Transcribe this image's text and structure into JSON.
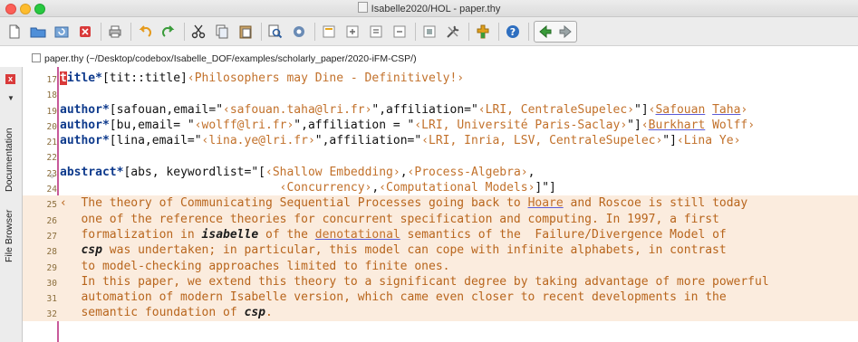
{
  "window": {
    "title": "Isabelle2020/HOL - paper.thy"
  },
  "toolbar": {
    "icons": [
      "new-file-icon",
      "open-folder-icon",
      "reload-icon",
      "close-icon",
      "print-icon",
      "undo-icon",
      "redo-icon",
      "cut-icon",
      "copy-icon",
      "paste-icon",
      "find-icon",
      "find-replace-icon",
      "fold-icon",
      "unfold-icon",
      "expand-icon",
      "collapse-icon",
      "select-icon",
      "tools-icon",
      "plugin-icon",
      "help-icon",
      "back-icon",
      "forward-icon"
    ]
  },
  "pathbar": {
    "path": "paper.thy (~/Desktop/codebox/Isabelle_DOF/examples/scholarly_paper/2020-iFM-CSP/)"
  },
  "dock": {
    "tabs": [
      "Documentation",
      "File Browser"
    ]
  },
  "editor": {
    "lines": [
      {
        "n": "17"
      },
      {
        "n": "18"
      },
      {
        "n": "19"
      },
      {
        "n": "20"
      },
      {
        "n": "21"
      },
      {
        "n": "22"
      },
      {
        "n": "23"
      },
      {
        "n": "24"
      },
      {
        "n": "25"
      },
      {
        "n": "26"
      },
      {
        "n": "27"
      },
      {
        "n": "28"
      },
      {
        "n": "29"
      },
      {
        "n": "30"
      },
      {
        "n": "31"
      },
      {
        "n": "32"
      }
    ],
    "l17": {
      "cur": "t",
      "kw": "itle*",
      "plain": "[tit::title]",
      "str": "‹Philosophers may Dine - Definitively!›"
    },
    "l19": {
      "kw": "author*",
      "a": "[safouan,email=\"",
      "s1": "‹safouan.taha@lri.fr›",
      "b": "\",affiliation=\"",
      "s2": "‹LRI, CentraleSupelec›",
      "c": "\"]",
      "s3a": "‹",
      "l1": "Safouan",
      "sp": " ",
      "l2": "Taha",
      "s3b": "›"
    },
    "l20": {
      "kw": "author*",
      "a": "[bu,email= \"",
      "s1": "‹wolff@lri.fr›",
      "b": "\",affiliation = \"",
      "s2": "‹LRI, Université Paris-Saclay›",
      "c": "\"]",
      "s3a": "‹",
      "l1": "Burkhart",
      "s3b": " Wolff›"
    },
    "l21": {
      "kw": "author*",
      "a": "[lina,email=\"",
      "s1": "‹lina.ye@lri.fr›",
      "b": "\",affiliation=\"",
      "s2": "‹LRI, Inria, LSV, CentraleSupelec›",
      "c": "\"]",
      "s3": "‹Lina Ye›"
    },
    "l23": {
      "kw": "abstract*",
      "a": "[abs, keywordlist=\"[",
      "s1": "‹Shallow Embedding›",
      "b": ",",
      "s2": "‹Process-Algebra›",
      "c": ","
    },
    "l24": {
      "pad": "                               ",
      "s1": "‹Concurrency›",
      "b": ",",
      "s2": "‹Computational Models›",
      "c": "]\"]"
    },
    "l25": {
      "a": "‹  The theory of Communicating Sequential Processes going back to ",
      "l1": "Hoare",
      "b": " and Roscoe is still today"
    },
    "l26": {
      "a": "   one of the reference theories for concurrent specification and computing. In 1997, a first"
    },
    "l27": {
      "a": "   formalization in ",
      "i": "isabelle",
      "b": " of the ",
      "l1": "denotational",
      "c": " semantics of the  Failure/Divergence Model of"
    },
    "l28": {
      "a": "   ",
      "i": "csp",
      "b": " was undertaken; in particular, this model can cope with infinite alphabets, in contrast"
    },
    "l29": {
      "a": "   to model-checking approaches limited to finite ones."
    },
    "l30": {
      "a": "   In this paper, we extend this theory to a significant degree by taking advantage of more powerful"
    },
    "l31": {
      "a": "   automation of modern Isabelle version, which came even closer to recent developments in the"
    },
    "l32": {
      "a": "   semantic foundation of ",
      "i": "csp",
      "b": "."
    }
  }
}
